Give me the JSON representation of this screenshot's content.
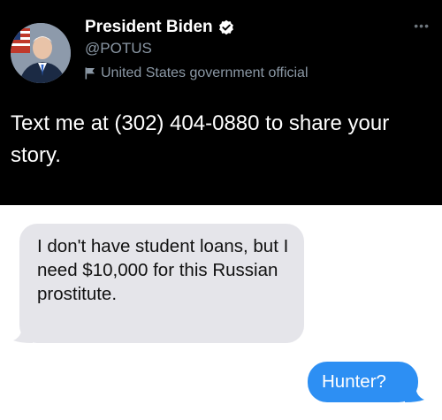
{
  "tweet": {
    "display_name": "President Biden",
    "handle": "@POTUS",
    "label": "United States government official",
    "text": "Text me at (302) 404-0880 to share your story.",
    "more_icon": "more-dots-icon"
  },
  "messages": {
    "received": "I don't have student loans, but I need $10,000 for this Russian prostitute.",
    "sent": "Hunter?"
  },
  "colors": {
    "tweet_background": "#000000",
    "verified_badge": "#ffffff",
    "received_bubble": "#e5e5ea",
    "sent_bubble": "#2d8ff3"
  }
}
